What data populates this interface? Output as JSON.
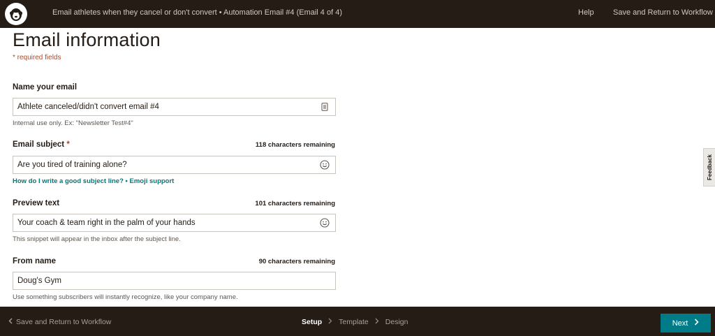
{
  "topbar": {
    "logo": "mailchimp-freddie-icon",
    "title": "Email athletes when they cancel or don't convert • Automation Email #4 (Email 4 of 4)",
    "help": "Help",
    "save_return": "Save and Return to Workflow"
  },
  "main": {
    "heading": "Email information",
    "required_note": "* required fields",
    "fields": {
      "name": {
        "label": "Name your email",
        "value": "Athlete canceled/didn't convert email #4",
        "icon": "merge-tag-icon",
        "hint": "Internal use only. Ex: \"Newsletter Test#4\""
      },
      "subject": {
        "label": "Email subject",
        "required_mark": "*",
        "counter": "118 characters remaining",
        "value": "Are you tired of training alone?",
        "icon": "emoji-icon",
        "link_1": "How do I write a good subject line?",
        "link_sep": "•",
        "link_2": "Emoji support"
      },
      "preview": {
        "label": "Preview text",
        "counter": "101 characters remaining",
        "value": "Your coach & team right in the palm of your hands",
        "icon": "emoji-icon",
        "hint": "This snippet will appear in the inbox after the subject line."
      },
      "from_name": {
        "label": "From name",
        "counter": "90 characters remaining",
        "value": "Doug's Gym",
        "hint": "Use something subscribers will instantly recognize, like your company name."
      }
    }
  },
  "feedback": {
    "label": "Feedback"
  },
  "bottombar": {
    "back": "Save and Return to Workflow",
    "steps": [
      {
        "label": "Setup",
        "active": true
      },
      {
        "label": "Template",
        "active": false
      },
      {
        "label": "Design",
        "active": false
      }
    ],
    "next": "Next"
  },
  "colors": {
    "bar": "#241c15",
    "accent": "#007c89",
    "link": "#00797d",
    "required": "#c0392b"
  }
}
